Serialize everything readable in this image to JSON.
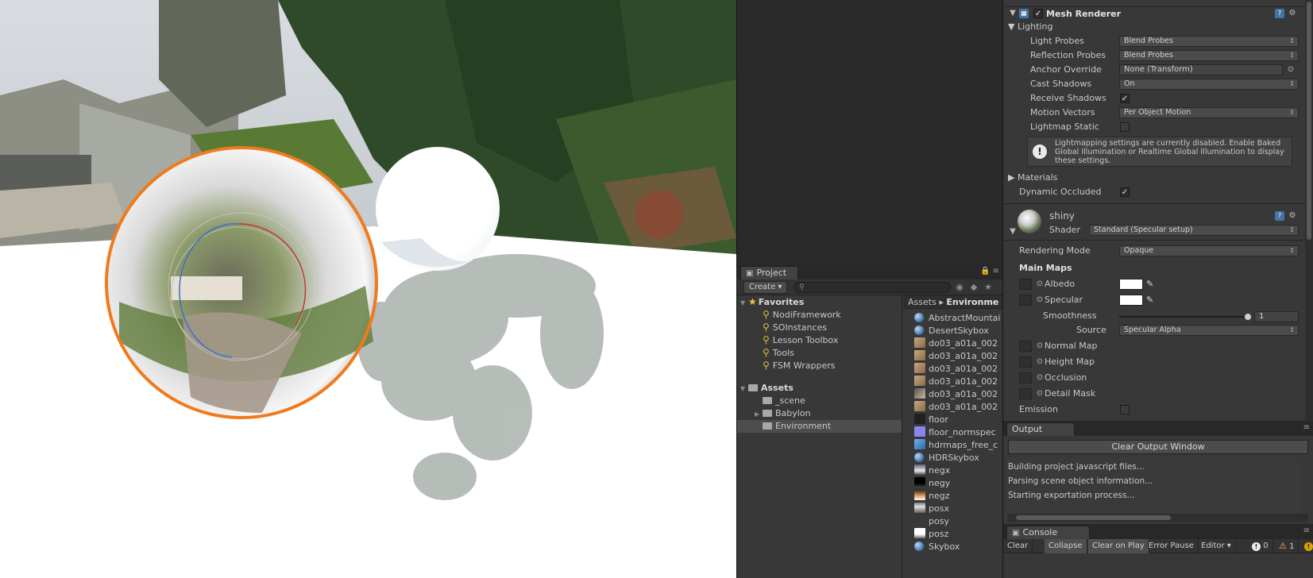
{
  "colors": {
    "selection_outline": "#f07a1c",
    "accent_blue": "#4674a6",
    "panel_bg": "#383838"
  },
  "project": {
    "tab_label": "Project",
    "create_label": "Create",
    "favorites_label": "Favorites",
    "favorites": [
      "NodiFramework",
      "SOInstances",
      "Lesson Toolbox",
      "Tools",
      "FSM Wrappers"
    ],
    "assets_label": "Assets",
    "folders": [
      {
        "label": "_scene",
        "expandable": false
      },
      {
        "label": "Babylon",
        "expandable": true
      },
      {
        "label": "Environment",
        "expandable": false
      }
    ],
    "breadcrumb_root": "Assets",
    "breadcrumb_sep": "▸",
    "breadcrumb_current": "Environme",
    "asset_items": [
      {
        "label": "AbstractMountai",
        "icon": "sphere"
      },
      {
        "label": "DesertSkybox",
        "icon": "sphere"
      },
      {
        "label": "do03_a01a_002",
        "icon": "tex"
      },
      {
        "label": "do03_a01a_002",
        "icon": "tex"
      },
      {
        "label": "do03_a01a_002",
        "icon": "tex"
      },
      {
        "label": "do03_a01a_002",
        "icon": "tex"
      },
      {
        "label": "do03_a01a_002",
        "icon": "tex2"
      },
      {
        "label": "do03_a01a_002",
        "icon": "tex"
      },
      {
        "label": "floor",
        "icon": "dark"
      },
      {
        "label": "floor_normspec",
        "icon": "norm"
      },
      {
        "label": "hdrmaps_free_c",
        "icon": "prefab"
      },
      {
        "label": "HDRSkybox",
        "icon": "sphere"
      },
      {
        "label": "negx",
        "icon": "sky"
      },
      {
        "label": "negy",
        "icon": "black"
      },
      {
        "label": "negz",
        "icon": "dusk"
      },
      {
        "label": "posx",
        "icon": "day"
      },
      {
        "label": "posy",
        "icon": "none"
      },
      {
        "label": "posz",
        "icon": "white"
      },
      {
        "label": "Skybox",
        "icon": "sphere"
      }
    ]
  },
  "inspector": {
    "mesh_renderer": {
      "title": "Mesh Renderer",
      "enabled": true,
      "lighting_label": "Lighting",
      "light_probes_label": "Light Probes",
      "light_probes_value": "Blend Probes",
      "reflection_probes_label": "Reflection Probes",
      "reflection_probes_value": "Blend Probes",
      "anchor_override_label": "Anchor Override",
      "anchor_override_value": "None (Transform)",
      "cast_shadows_label": "Cast Shadows",
      "cast_shadows_value": "On",
      "receive_shadows_label": "Receive Shadows",
      "receive_shadows_checked": true,
      "motion_vectors_label": "Motion Vectors",
      "motion_vectors_value": "Per Object Motion",
      "lightmap_static_label": "Lightmap Static",
      "lightmap_static_checked": false,
      "lightmap_help": "Lightmapping settings are currently disabled. Enable Baked Global Illumination or Realtime Global Illumination to display these settings.",
      "materials_label": "Materials",
      "dynamic_occluded_label": "Dynamic Occluded",
      "dynamic_occluded_checked": true
    },
    "material": {
      "name": "shiny",
      "shader_label": "Shader",
      "shader_value": "Standard (Specular setup)",
      "rendering_mode_label": "Rendering Mode",
      "rendering_mode_value": "Opaque",
      "main_maps_label": "Main Maps",
      "albedo_label": "Albedo",
      "specular_label": "Specular",
      "smoothness_label": "Smoothness",
      "smoothness_value": "1",
      "smoothness_fraction": 1.0,
      "source_label": "Source",
      "source_value": "Specular Alpha",
      "normal_map_label": "Normal Map",
      "height_map_label": "Height Map",
      "occlusion_label": "Occlusion",
      "detail_mask_label": "Detail Mask",
      "emission_label": "Emission"
    }
  },
  "output": {
    "tab_label": "Output",
    "clear_button": "Clear Output Window",
    "lines": [
      "Building project javascript files...",
      "Parsing scene object information...",
      "Starting exportation process..."
    ]
  },
  "console": {
    "tab_label": "Console",
    "clear": "Clear",
    "collapse": "Collapse",
    "clear_on_play": "Clear on Play",
    "error_pause": "Error Pause",
    "editor": "Editor",
    "info_count": "0",
    "warning_count": "1"
  }
}
